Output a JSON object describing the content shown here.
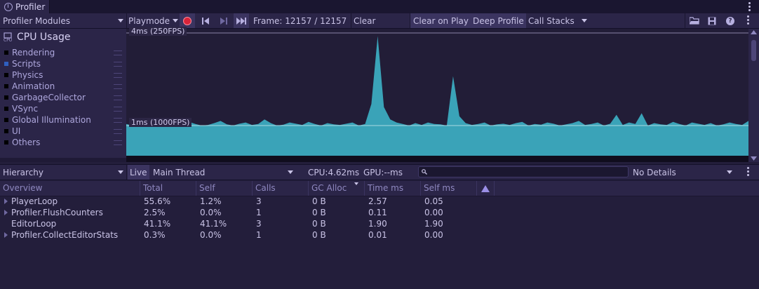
{
  "window": {
    "tab_title": "Profiler"
  },
  "toolbar": {
    "modules_label": "Profiler Modules",
    "playmode_label": "Playmode",
    "frame_label": "Frame: 12157 / 12157",
    "clear_label": "Clear",
    "clear_on_play_label": "Clear on Play",
    "deep_profile_label": "Deep Profile",
    "call_stacks_label": "Call Stacks"
  },
  "legend": {
    "title": "CPU Usage",
    "items": [
      {
        "label": "Rendering",
        "color": "#000000"
      },
      {
        "label": "Scripts",
        "color": "#2f5fbf"
      },
      {
        "label": "Physics",
        "color": "#000000"
      },
      {
        "label": "Animation",
        "color": "#000000"
      },
      {
        "label": "GarbageCollector",
        "color": "#000000"
      },
      {
        "label": "VSync",
        "color": "#000000"
      },
      {
        "label": "Global Illumination",
        "color": "#000000"
      },
      {
        "label": "UI",
        "color": "#000000"
      },
      {
        "label": "Others",
        "color": "#000000"
      }
    ]
  },
  "chart": {
    "top_line_label": "4ms (250FPS)",
    "mid_line_label": "1ms (1000FPS)",
    "series_color": "#3aa3b8"
  },
  "chart_data": {
    "type": "area",
    "series": [
      {
        "name": "Scripts",
        "values": [
          1.05,
          1.0,
          1.02,
          1.08,
          1.0,
          1.04,
          1.1,
          1.0,
          1.03,
          1.06,
          1.12,
          1.05,
          1.0,
          1.02,
          1.08,
          1.15,
          1.04,
          1.0,
          1.06,
          1.1,
          1.02,
          1.05,
          1.2,
          1.08,
          1.0,
          1.03,
          1.1,
          1.06,
          1.02,
          1.12,
          1.05,
          1.0,
          1.08,
          1.04,
          1.02,
          1.06,
          1.1,
          1.0,
          1.05,
          1.7,
          3.9,
          1.6,
          1.2,
          1.1,
          1.05,
          1.0,
          1.08,
          1.02,
          1.1,
          1.05,
          1.04,
          1.0,
          2.6,
          1.3,
          1.08,
          1.02,
          1.05,
          1.1,
          1.0,
          1.04,
          1.06,
          1.02,
          1.08,
          1.12,
          1.0,
          1.05,
          1.03,
          1.1,
          1.06,
          1.0,
          1.04,
          1.08,
          1.15,
          1.02,
          1.05,
          1.1,
          1.0,
          1.06,
          1.35,
          1.02,
          1.1,
          1.05,
          1.4,
          1.0,
          1.08,
          1.04,
          1.02,
          1.12,
          1.05,
          1.0,
          1.1,
          1.06,
          1.02,
          1.08,
          1.0,
          1.04,
          1.1,
          1.05,
          1.02,
          1.15
        ]
      }
    ],
    "ylabel": "",
    "reference_lines": [
      "4ms (250FPS)",
      "1ms (1000FPS)"
    ]
  },
  "lower": {
    "view_label": "Hierarchy",
    "live_label": "Live",
    "thread_label": "Main Thread",
    "cpu_label": "CPU:4.62ms",
    "gpu_label": "GPU:--ms",
    "details_label": "No Details"
  },
  "table": {
    "columns": [
      "Overview",
      "Total",
      "Self",
      "Calls",
      "GC Alloc",
      "Time ms",
      "Self ms"
    ],
    "rows": [
      {
        "name": "PlayerLoop",
        "expandable": true,
        "total": "55.6%",
        "self": "1.2%",
        "calls": "3",
        "gc": "0 B",
        "time": "2.57",
        "selfms": "0.05"
      },
      {
        "name": "Profiler.FlushCounters",
        "expandable": true,
        "total": "2.5%",
        "self": "0.0%",
        "calls": "1",
        "gc": "0 B",
        "time": "0.11",
        "selfms": "0.00"
      },
      {
        "name": "EditorLoop",
        "expandable": false,
        "total": "41.1%",
        "self": "41.1%",
        "calls": "3",
        "gc": "0 B",
        "time": "1.90",
        "selfms": "1.90"
      },
      {
        "name": "Profiler.CollectEditorStats",
        "expandable": true,
        "total": "0.3%",
        "self": "0.0%",
        "calls": "1",
        "gc": "0 B",
        "time": "0.01",
        "selfms": "0.00"
      }
    ]
  }
}
